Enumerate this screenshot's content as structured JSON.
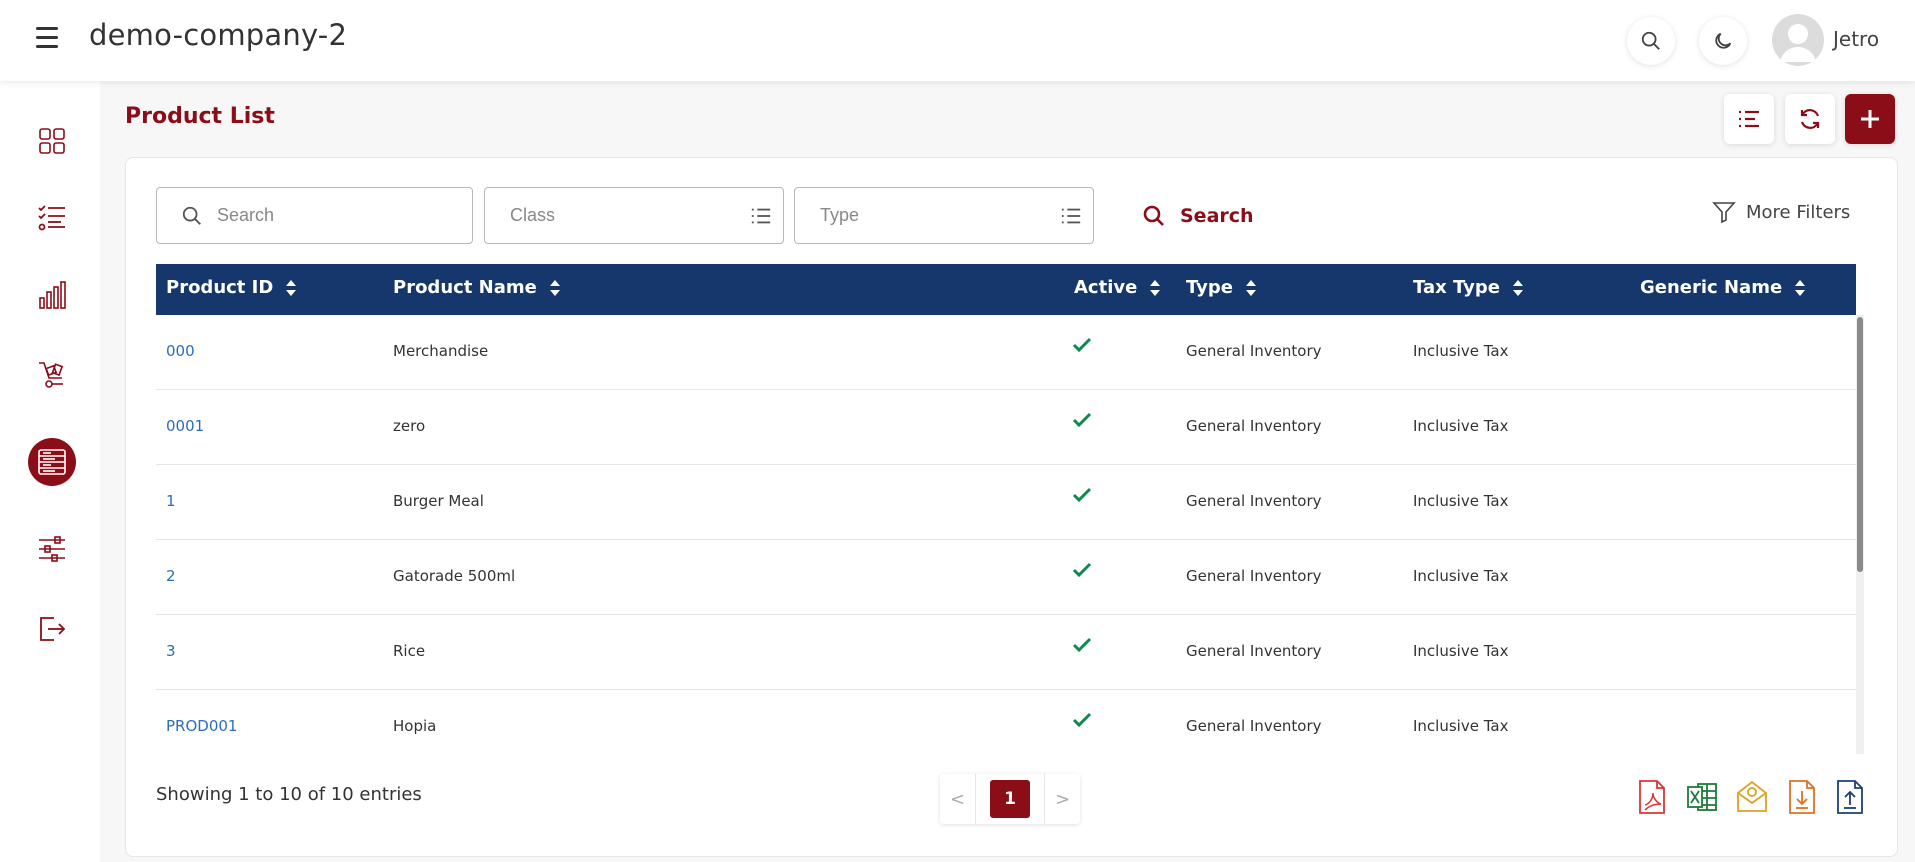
{
  "app": {
    "company_name": "demo-company-2",
    "username": "Jetro"
  },
  "header": {
    "icons": [
      "menu-icon",
      "search-icon",
      "moon-icon",
      "user-avatar-icon"
    ]
  },
  "sidebar": {
    "items": [
      {
        "name": "dashboard-grid-icon",
        "active": false
      },
      {
        "name": "checklist-icon",
        "active": false
      },
      {
        "name": "bar-chart-icon",
        "active": false
      },
      {
        "name": "cart-icon",
        "active": false
      },
      {
        "name": "products-list-icon",
        "active": true
      },
      {
        "name": "sliders-icon",
        "active": false
      },
      {
        "name": "logout-icon",
        "active": false
      }
    ]
  },
  "page": {
    "title": "Product List"
  },
  "toolbar": {
    "icons": [
      "list-view-icon",
      "refresh-icon",
      "add-icon"
    ]
  },
  "filters": {
    "search_placeholder": "Search",
    "class_placeholder": "Class",
    "type_placeholder": "Type",
    "search_button": "Search",
    "more_filters": "More Filters"
  },
  "table": {
    "columns": [
      "Product ID",
      "Product Name",
      "Active",
      "Type",
      "Tax Type",
      "Generic Name"
    ],
    "rows": [
      {
        "id": "000",
        "name": "Merchandise",
        "active": true,
        "type": "General Inventory",
        "tax_type": "Inclusive Tax",
        "generic_name": ""
      },
      {
        "id": "0001",
        "name": "zero",
        "active": true,
        "type": "General Inventory",
        "tax_type": "Inclusive Tax",
        "generic_name": ""
      },
      {
        "id": "1",
        "name": "Burger Meal",
        "active": true,
        "type": "General Inventory",
        "tax_type": "Inclusive Tax",
        "generic_name": ""
      },
      {
        "id": "2",
        "name": "Gatorade 500ml",
        "active": true,
        "type": "General Inventory",
        "tax_type": "Inclusive Tax",
        "generic_name": ""
      },
      {
        "id": "3",
        "name": "Rice",
        "active": true,
        "type": "General Inventory",
        "tax_type": "Inclusive Tax",
        "generic_name": ""
      },
      {
        "id": "PROD001",
        "name": "Hopia",
        "active": true,
        "type": "General Inventory",
        "tax_type": "Inclusive Tax",
        "generic_name": ""
      }
    ]
  },
  "footer": {
    "entries_text": "Showing 1 to 10 of 10 entries",
    "current_page": "1",
    "prev": "<",
    "next": ">",
    "export_icons": [
      "pdf-icon",
      "excel-icon",
      "email-icon",
      "download-icon",
      "upload-icon"
    ]
  },
  "colors": {
    "brand": "#8b0d18",
    "table_header": "#15376b",
    "link": "#2b6cc4",
    "check": "#0f8a4f"
  }
}
